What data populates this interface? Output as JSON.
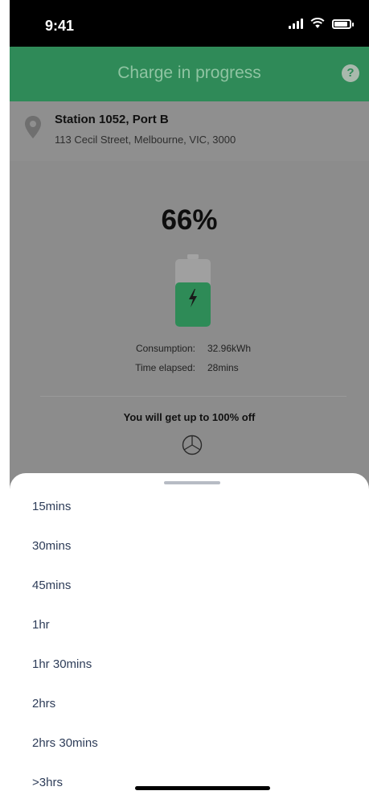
{
  "status_bar": {
    "time": "9:41"
  },
  "header": {
    "title": "Charge in progress",
    "help": "?"
  },
  "station": {
    "name": "Station 1052, Port B",
    "address": "113 Cecil Street, Melbourne, VIC, 3000"
  },
  "charge": {
    "percent": "66%",
    "battery_level": 0.66,
    "consumption_label": "Consumption:",
    "consumption_value": "32.96kWh",
    "elapsed_label": "Time elapsed:",
    "elapsed_value": "28mins",
    "offer": "You will get up to 100% off"
  },
  "sheet": {
    "options": [
      "15mins",
      "30mins",
      "45mins",
      "1hr",
      "1hr 30mins",
      "2hrs",
      "2hrs 30mins",
      ">3hrs"
    ]
  },
  "colors": {
    "header_green": "#2f8a58",
    "battery_green": "#2e8b57",
    "overlay_gray": "#8c8c8c"
  },
  "icons": [
    "signal-icon",
    "wifi-icon",
    "battery-status-icon",
    "help-icon",
    "location-pin-icon",
    "battery-charging-icon",
    "brand-logo-icon"
  ]
}
